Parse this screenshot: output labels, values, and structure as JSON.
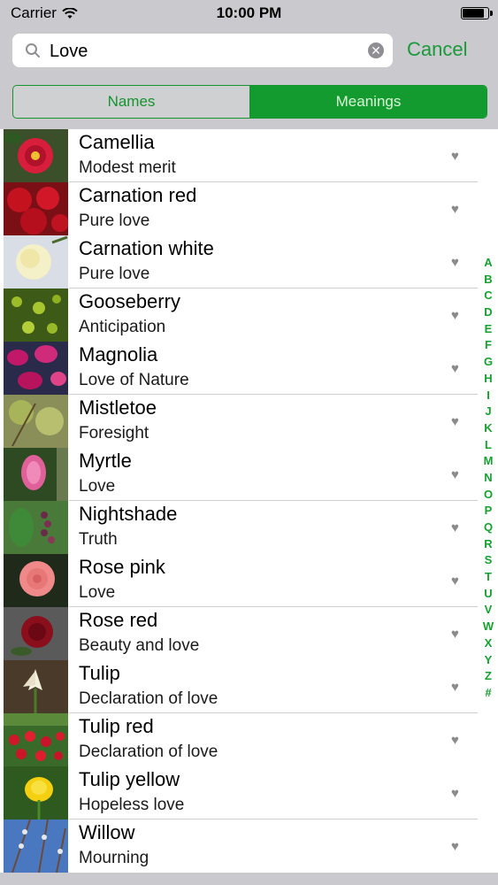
{
  "status": {
    "carrier": "Carrier",
    "time": "10:00 PM"
  },
  "search": {
    "value": "Love",
    "cancel_label": "Cancel"
  },
  "segments": {
    "names": "Names",
    "meanings": "Meanings",
    "selected": "meanings"
  },
  "colors": {
    "accent": "#149b2f",
    "chrome": "#c9c9ce"
  },
  "rows": [
    {
      "name": "Camellia",
      "meaning": "Modest merit",
      "image": "red-camellia-flower"
    },
    {
      "name": "Carnation red",
      "meaning": "Pure love",
      "image": "red-carnations"
    },
    {
      "name": "Carnation white",
      "meaning": "Pure love",
      "image": "white-carnation"
    },
    {
      "name": "Gooseberry",
      "meaning": "Anticipation",
      "image": "gooseberry-bush"
    },
    {
      "name": "Magnolia",
      "meaning": "Love of Nature",
      "image": "pink-magnolia"
    },
    {
      "name": "Mistletoe",
      "meaning": "Foresight",
      "image": "mistletoe-branches"
    },
    {
      "name": "Myrtle",
      "meaning": "Love",
      "image": "pink-myrtle-blossom"
    },
    {
      "name": "Nightshade",
      "meaning": "Truth",
      "image": "nightshade-berries"
    },
    {
      "name": "Rose pink",
      "meaning": "Love",
      "image": "pink-rose"
    },
    {
      "name": "Rose red",
      "meaning": "Beauty and love",
      "image": "red-rose"
    },
    {
      "name": "Tulip",
      "meaning": "Declaration of love",
      "image": "white-tulip"
    },
    {
      "name": "Tulip red",
      "meaning": "Declaration of love",
      "image": "red-tulips-field"
    },
    {
      "name": "Tulip yellow",
      "meaning": "Hopeless love",
      "image": "yellow-tulip"
    },
    {
      "name": "Willow",
      "meaning": "Mourning",
      "image": "willow-catkins"
    }
  ],
  "index_letters": [
    "A",
    "B",
    "C",
    "D",
    "E",
    "F",
    "G",
    "H",
    "I",
    "J",
    "K",
    "L",
    "M",
    "N",
    "O",
    "P",
    "Q",
    "R",
    "S",
    "T",
    "U",
    "V",
    "W",
    "X",
    "Y",
    "Z",
    "#"
  ]
}
